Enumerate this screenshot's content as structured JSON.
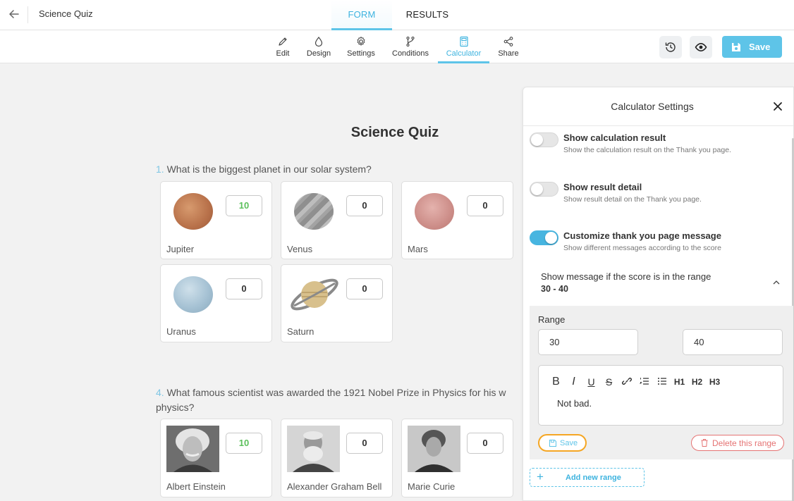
{
  "topbar": {
    "app_title": "Science Quiz",
    "tabs": [
      {
        "label": "FORM",
        "active": true
      },
      {
        "label": "RESULTS",
        "active": false
      }
    ]
  },
  "toolbar": {
    "tools": [
      {
        "label": "Edit",
        "icon": "pencil-icon"
      },
      {
        "label": "Design",
        "icon": "droplet-icon"
      },
      {
        "label": "Settings",
        "icon": "gear-icon"
      },
      {
        "label": "Conditions",
        "icon": "branch-icon"
      },
      {
        "label": "Calculator",
        "icon": "calculator-icon",
        "active": true
      },
      {
        "label": "Share",
        "icon": "share-icon"
      }
    ],
    "history_icon": "history-icon",
    "preview_icon": "eye-icon",
    "save_label": "Save",
    "accent": "#5ec4e8"
  },
  "form": {
    "title": "Science Quiz",
    "questions": [
      {
        "number": "1.",
        "text": "What is the biggest planet in our solar system?",
        "answers": [
          {
            "name": "Jupiter",
            "score": "10"
          },
          {
            "name": "Venus",
            "score": "0"
          },
          {
            "name": "Mars",
            "score": "0"
          },
          {
            "name": "Uranus",
            "score": "0"
          },
          {
            "name": "Saturn",
            "score": "0"
          }
        ]
      },
      {
        "number": "4.",
        "text": "What famous scientist was awarded the 1921 Nobel Prize in Physics for his w",
        "text_line2": "physics?",
        "answers": [
          {
            "name": "Albert Einstein",
            "score": "10"
          },
          {
            "name": "Alexander Graham Bell",
            "score": "0"
          },
          {
            "name": "Marie Curie",
            "score": "0"
          }
        ]
      }
    ]
  },
  "calculator": {
    "title": "Calculator Settings",
    "options": [
      {
        "title": "Show calculation result",
        "desc": "Show the calculation result on the Thank you page.",
        "on": false
      },
      {
        "title": "Show result detail",
        "desc": "Show result detail on the Thank you page.",
        "on": false
      },
      {
        "title": "Customize thank you page message",
        "desc": "Show different messages according to the score",
        "on": true
      }
    ],
    "range_header": {
      "label": "Show message if the score is in the range",
      "value": "30 - 40"
    },
    "range": {
      "label": "Range",
      "min": "30",
      "max": "40",
      "toolbar": [
        "B",
        "I",
        "U",
        "S",
        "link",
        "ol",
        "ul",
        "H1",
        "H2",
        "H3"
      ],
      "message": "Not bad.",
      "save_label": "Save",
      "delete_label": "Delete this range"
    },
    "add_range_label": "Add new range"
  }
}
